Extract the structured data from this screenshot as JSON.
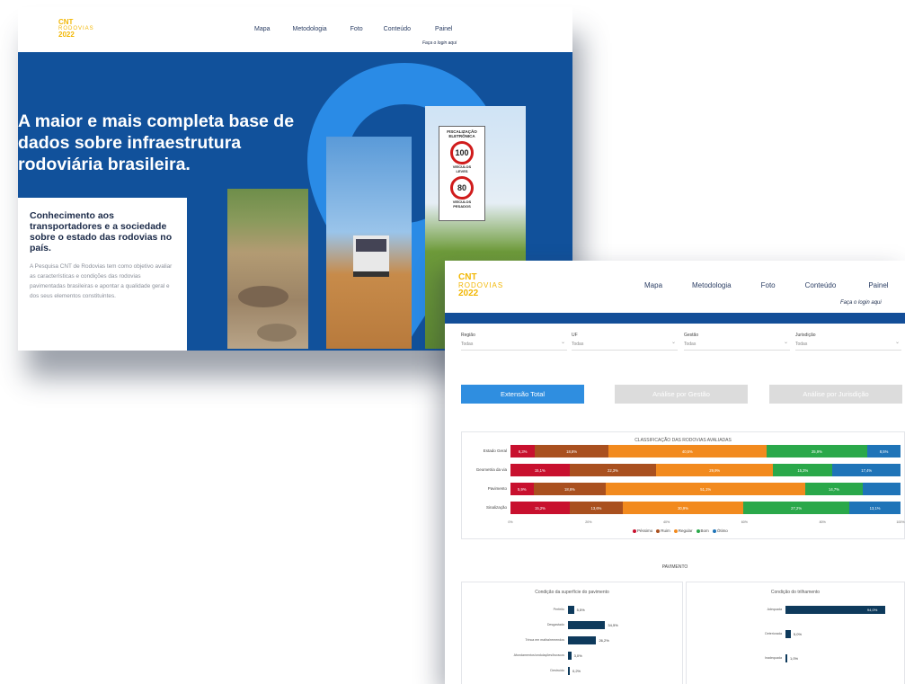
{
  "window1": {
    "logo": {
      "line1": "CNT",
      "line2": "RODOVIAS",
      "line3": "2022"
    },
    "menu": [
      "Mapa",
      "Metodologia",
      "Foto",
      "Conteúdo",
      "Painel"
    ],
    "login": "Faça o login aqui",
    "hero_title": "A maior e mais completa base de dados sobre infraestrutura rodoviária brasileira.",
    "card_title": "Conhecimento aos transportadores e a sociedade sobre o estado das rodovias no país.",
    "card_text": "A Pesquisa CNT de Rodovias tem como objetivo avaliar as características e condições das rodovias pavimentadas brasileiras e apontar a qualidade geral e dos seus elementos constituintes.",
    "sign": {
      "line1": "FISCALIZAÇÃO",
      "line2": "ELETRÔNICA",
      "speed1": "100",
      "label1a": "VEÍCULOS",
      "label1b": "LEVES",
      "speed2": "80",
      "label2a": "VEÍCULOS",
      "label2b": "PESADOS"
    }
  },
  "window2": {
    "logo": {
      "line1": "CNT",
      "line2": "RODOVIAS",
      "line3": "2022"
    },
    "menu": [
      "Mapa",
      "Metodologia",
      "Foto",
      "Conteúdo",
      "Painel"
    ],
    "login": "Faça o login aqui",
    "filters": [
      {
        "label": "Região",
        "value": "Todas"
      },
      {
        "label": "UF",
        "value": "Todas"
      },
      {
        "label": "Gestão",
        "value": "Todas"
      },
      {
        "label": "Jurisdição",
        "value": "Todas"
      }
    ],
    "tabs": [
      "Extensão Total",
      "Análise por Gestão",
      "Análise por Jurisdição"
    ],
    "colors": {
      "pessimo": "#c8102e",
      "ruim": "#a9501f",
      "regular": "#f28a1e",
      "bom": "#2aa84a",
      "otimo": "#1f74b8",
      "navy": "#0e3a5c",
      "tab_active": "#2f8ee0",
      "tab_inactive": "#dcdcdc"
    },
    "pavimento_title": "PAVIMENTO",
    "pavimento_charts": [
      {
        "type": "bar",
        "title": "Condição da superfície do pavimento",
        "categories": [
          "Perfeito",
          "Desgastado",
          "Trinca em malha/remendos",
          "Afundamentos/ondulações/buracos",
          "Destruído"
        ],
        "values": [
          5.5,
          34.5,
          26.2,
          3.0,
          0.2
        ],
        "labels": [
          "5,5%",
          "34,5%",
          "26,2%",
          "3,0%",
          "0,2%"
        ]
      },
      {
        "type": "bar",
        "title": "Condição do trilhamento",
        "categories": [
          "Adequada",
          "Deteriorada",
          "Inadequada"
        ],
        "values": [
          94.0,
          5.0,
          1.0
        ],
        "labels": [
          "94,0%",
          "5,0%",
          "1,0%"
        ]
      }
    ]
  },
  "chart_data": {
    "type": "bar",
    "stacked": true,
    "orientation": "horizontal",
    "title": "CLASSIFICAÇÃO DAS RODOVIAS AVALIADAS",
    "categories": [
      "Estado Geral",
      "Geometria da via",
      "Pavimento",
      "Sinalização"
    ],
    "series": [
      {
        "name": "Péssimo",
        "values": [
          6.3,
          15.1,
          5.9,
          15.2
        ],
        "labels": [
          "6,3%",
          "15,1%",
          "5,9%",
          "15,2%"
        ]
      },
      {
        "name": "Ruim",
        "values": [
          18.8,
          22.3,
          18.6,
          13.6
        ],
        "labels": [
          "18,8%",
          "22,3%",
          "18,6%",
          "13,6%"
        ]
      },
      {
        "name": "Regular",
        "values": [
          40.5,
          29.9,
          51.1,
          30.9
        ],
        "labels": [
          "40,5%",
          "29,9%",
          "51,1%",
          "30,9%"
        ]
      },
      {
        "name": "Bom",
        "values": [
          25.9,
          15.3,
          14.7,
          27.2
        ],
        "labels": [
          "25,9%",
          "15,3%",
          "14,7%",
          "27,2%"
        ]
      },
      {
        "name": "Ótimo",
        "values": [
          8.5,
          17.4,
          9.7,
          13.1
        ],
        "labels": [
          "8,5%",
          "17,4%",
          "",
          "13,1%"
        ]
      }
    ],
    "x_ticks": [
      "0%",
      "20%",
      "40%",
      "60%",
      "80%",
      "100%"
    ],
    "xlim": [
      0,
      100
    ],
    "legend_position": "bottom"
  }
}
